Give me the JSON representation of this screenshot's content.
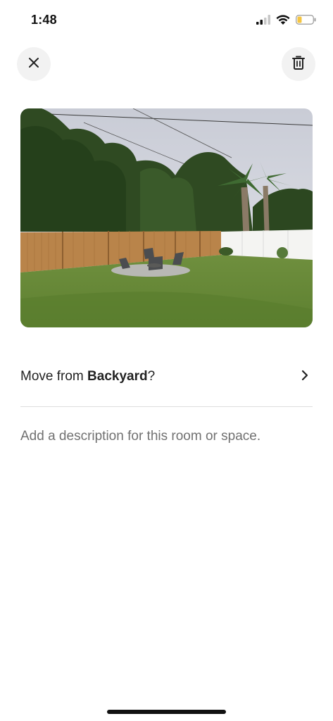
{
  "status_bar": {
    "time": "1:48",
    "icons": [
      "cellular-signal-icon",
      "wifi-icon",
      "battery-icon"
    ],
    "battery_color": "#f5c542"
  },
  "header": {
    "close_icon": "close-icon",
    "delete_icon": "trash-icon"
  },
  "photo": {
    "subject": "backyard-photo"
  },
  "move_row": {
    "prefix": "Move from ",
    "room": "Backyard",
    "suffix": "?",
    "icon": "chevron-right-icon"
  },
  "description": {
    "placeholder": "Add a description for this room or space.",
    "value": ""
  },
  "colors": {
    "text": "#222222",
    "placeholder": "#717171",
    "divider": "#dddddd",
    "button_bg": "#f2f2f2"
  }
}
